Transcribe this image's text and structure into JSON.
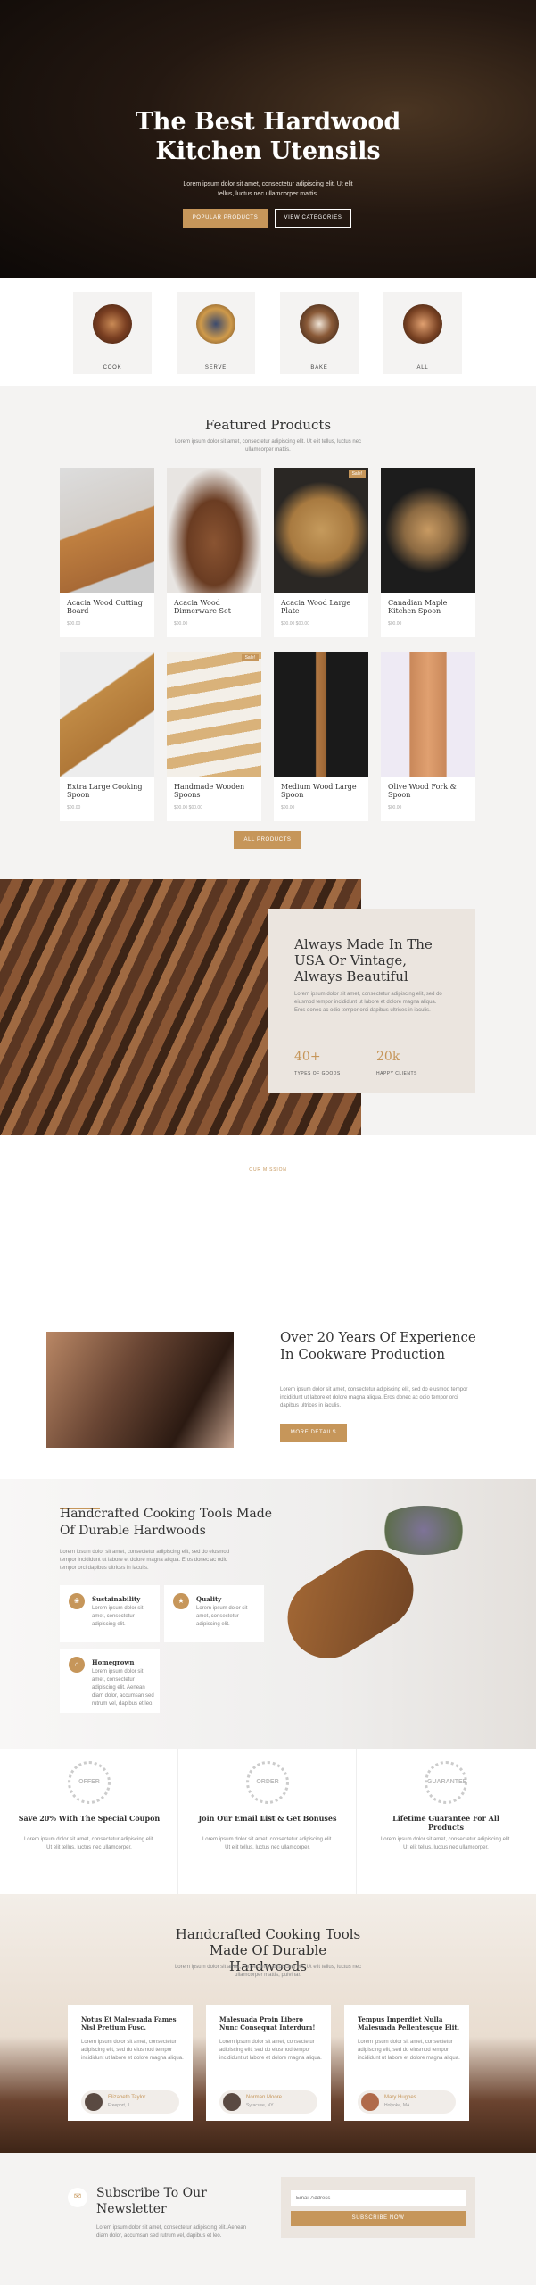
{
  "hero": {
    "title_line1": "The Best Hardwood",
    "title_line2": "Kitchen Utensils",
    "subtitle": "Lorem ipsum dolor sit amet, consectetur adipiscing elit. Ut elit tellus, luctus nec ullamcorper mattis.",
    "btn_products": "POPULAR PRODUCTS",
    "btn_categories": "VIEW CATEGORIES"
  },
  "categories": [
    {
      "label": "COOK"
    },
    {
      "label": "SERVE"
    },
    {
      "label": "BAKE"
    },
    {
      "label": "ALL"
    }
  ],
  "featured": {
    "title": "Featured Products",
    "subtitle": "Lorem ipsum dolor sit amet, consectetur adipiscing elit. Ut elit tellus, luctus nec ullamcorper mattis.",
    "all_button": "ALL PRODUCTS",
    "products": [
      {
        "name": "Acacia Wood Cutting Board",
        "price": "$00.00",
        "sale": ""
      },
      {
        "name": "Acacia Wood Dinnerware Set",
        "price": "$00.00",
        "sale": ""
      },
      {
        "name": "Acacia Wood Large Plate",
        "price": "$00.00 $00.00",
        "sale": "Sale!"
      },
      {
        "name": "Canadian Maple Kitchen Spoon",
        "price": "$00.00",
        "sale": ""
      },
      {
        "name": "Extra Large Cooking Spoon",
        "price": "$00.00",
        "sale": ""
      },
      {
        "name": "Handmade Wooden Spoons",
        "price": "$00.00 $00.00",
        "sale": "Sale!"
      },
      {
        "name": "Medium Wood Large Spoon",
        "price": "$00.00",
        "sale": ""
      },
      {
        "name": "Olive Wood Fork & Spoon",
        "price": "$00.00",
        "sale": ""
      }
    ]
  },
  "usa": {
    "title": "Always Made In The USA Or Vintage, Always Beautiful",
    "text": "Lorem ipsum dolor sit amet, consectetur adipiscing elit, sed do eiusmod tempor incididunt ut labore et dolore magna aliqua. Eros donec ac odio tempor orci dapibus ultrices in iaculis.",
    "stat1_value": "40+",
    "stat1_label": "TYPES OF GOODS",
    "stat2_value": "20k",
    "stat2_label": "HAPPY CLIENTS"
  },
  "mission": {
    "tag": "OUR MISSION",
    "title": "Over 20 Years Of Experience In Cookware Production",
    "text": "Lorem ipsum dolor sit amet, consectetur adipiscing elit, sed do eiusmod tempor incididunt ut labore et dolore magna aliqua. Eros donec ac odio tempor orci dapibus ultrices in iaculis.",
    "button": "MORE DETAILS"
  },
  "handcrafted": {
    "title": "Handcrafted Cooking Tools Made Of Durable Hardwoods",
    "text": "Lorem ipsum dolor sit amet, consectetur adipiscing elit, sed do eiusmod tempor incididunt ut labore et dolore magna aliqua. Eros donec ac odio tempor orci dapibus ultrices in iaculis.",
    "features": [
      {
        "title": "Sustainability",
        "text": "Lorem ipsum dolor sit amet, consectetur adipiscing elit."
      },
      {
        "title": "Quality",
        "text": "Lorem ipsum dolor sit amet, consectetur adipiscing elit."
      },
      {
        "title": "Homegrown",
        "text": "Lorem ipsum dolor sit amet, consectetur adipiscing elit. Aenean diam dolor, accumsan sed rutrum vel, dapibus et leo."
      }
    ]
  },
  "promos": [
    {
      "badge": "OFFER",
      "title": "Save 20% With The Special Coupon",
      "text": "Lorem ipsum dolor sit amet, consectetur adipiscing elit. Ut elit tellus, luctus nec ullamcorper."
    },
    {
      "badge": "ORDER NOW",
      "title": "Join Our Email List & Get Bonuses",
      "text": "Lorem ipsum dolor sit amet, consectetur adipiscing elit. Ut elit tellus, luctus nec ullamcorper."
    },
    {
      "badge": "GUARANTEE",
      "title": "Lifetime Guarantee For All Products",
      "text": "Lorem ipsum dolor sit amet, consectetur adipiscing elit. Ut elit tellus, luctus nec ullamcorper."
    }
  ],
  "testimonials": {
    "title": "Handcrafted Cooking Tools Made Of Durable Hardwoods",
    "subtitle": "Lorem ipsum dolor sit amet, consectetur adipiscing elit. Ut elit tellus, luctus nec ullamcorper mattis, pulvinar.",
    "items": [
      {
        "title": "Notus Et Malesuada Fames Nisl Pretium Fusc.",
        "text": "Lorem ipsum dolor sit amet, consectetur adipiscing elit, sed do eiusmod tempor incididunt ut labore et dolore magna aliqua.",
        "name": "Elizabeth Taylor",
        "location": "Freeport, IL"
      },
      {
        "title": "Malesuada Proin Libero Nunc Consequat Interdum!",
        "text": "Lorem ipsum dolor sit amet, consectetur adipiscing elit, sed do eiusmod tempor incididunt ut labore et dolore magna aliqua.",
        "name": "Norman Moore",
        "location": "Syracuse, NY"
      },
      {
        "title": "Tempus Imperdiet Nulla Malesuada Pellentesque Elit.",
        "text": "Lorem ipsum dolor sit amet, consectetur adipiscing elit, sed do eiusmod tempor incididunt ut labore et dolore magna aliqua.",
        "name": "Mary Hughes",
        "location": "Holyoke, MA"
      }
    ]
  },
  "newsletter": {
    "title": "Subscribe To Our Newsletter",
    "text": "Lorem ipsum dolor sit amet, consectetur adipiscing elit. Aenean diam dolor, accumsan sed rutrum vel, dapibus et leo.",
    "placeholder": "Email Address",
    "button": "SUBSCRIBE NOW"
  },
  "colors": {
    "accent": "#c6965a",
    "dark": "#1a120c",
    "light_bg": "#f4f3f2"
  },
  "icons": [
    "leaf-icon",
    "star-icon",
    "home-icon",
    "mail-icon"
  ]
}
